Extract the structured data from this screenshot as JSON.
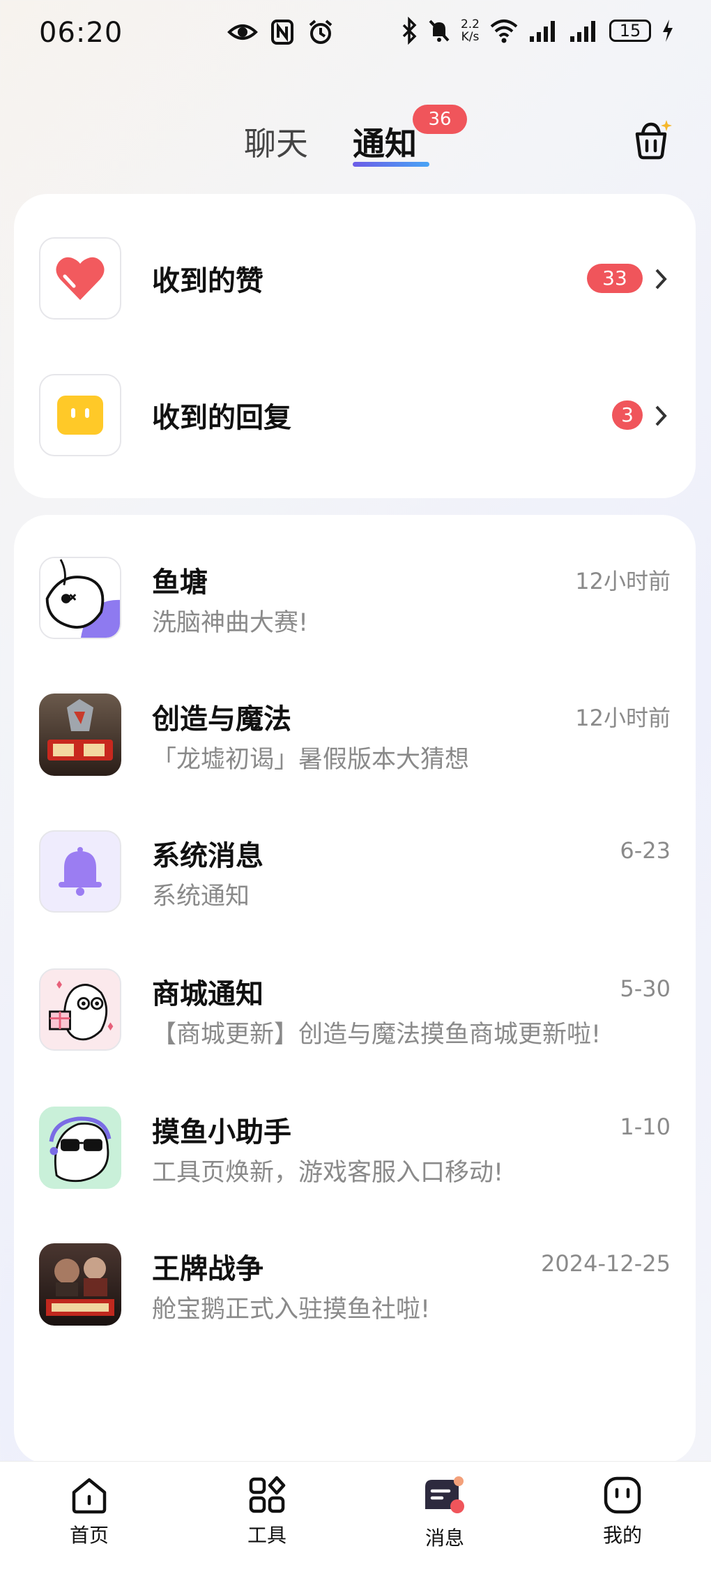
{
  "status_bar": {
    "time": "06:20",
    "net_speed_top": "2.2",
    "net_speed_bottom": "K/s",
    "battery": "15"
  },
  "tabs": {
    "chat": "聊天",
    "notify": "通知",
    "notify_badge": "36"
  },
  "summary": [
    {
      "title": "收到的赞",
      "count": "33",
      "icon": "heart-icon"
    },
    {
      "title": "收到的回复",
      "count": "3",
      "icon": "reply-icon"
    }
  ],
  "notifications": [
    {
      "title": "鱼塘",
      "subtitle": "洗脑神曲大赛!",
      "time": "12小时前",
      "icon": "fish-pond-icon"
    },
    {
      "title": "创造与魔法",
      "subtitle": "「龙墟初谒」暑假版本大猜想",
      "time": "12小时前",
      "icon": "game-creation-magic-icon"
    },
    {
      "title": "系统消息",
      "subtitle": "系统通知",
      "time": "6-23",
      "icon": "bell-icon"
    },
    {
      "title": "商城通知",
      "subtitle": "【商城更新】创造与魔法摸鱼商城更新啦!",
      "time": "5-30",
      "icon": "mall-mascot-icon"
    },
    {
      "title": "摸鱼小助手",
      "subtitle": "工具页焕新，游戏客服入口移动!",
      "time": "1-10",
      "icon": "assistant-mascot-icon"
    },
    {
      "title": "王牌战争",
      "subtitle": "舱宝鹅正式入驻摸鱼社啦!",
      "time": "2024-12-25",
      "icon": "game-war-icon"
    }
  ],
  "bottom_nav": [
    {
      "label": "首页",
      "icon": "home-icon"
    },
    {
      "label": "工具",
      "icon": "tools-icon"
    },
    {
      "label": "消息",
      "icon": "message-icon"
    },
    {
      "label": "我的",
      "icon": "profile-icon"
    }
  ],
  "colors": {
    "badge_red": "#f0555b",
    "accent_purple": "#6c5ce7",
    "accent_blue": "#48a4f5",
    "heart_red": "#f25a5e",
    "reply_yellow": "#ffc928",
    "bell_purple": "#9b7df2"
  }
}
